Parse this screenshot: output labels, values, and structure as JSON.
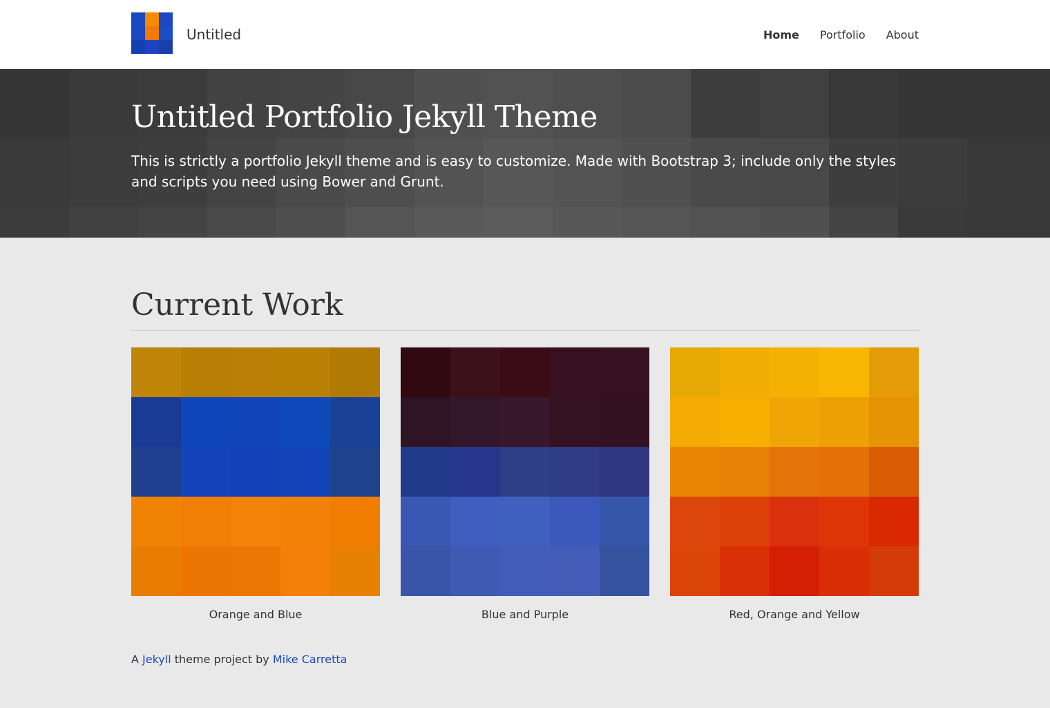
{
  "navbar": {
    "brand": "Untitled",
    "logo_colors": [
      "#1c47c0",
      "#f48a00",
      "#1c47c0",
      "#1c47c0",
      "#f07a08",
      "#1a4ec8",
      "#1240b0",
      "#1e44c2",
      "#1c3ea8"
    ],
    "items": [
      {
        "label": "Home",
        "active": true
      },
      {
        "label": "Portfolio",
        "active": false
      },
      {
        "label": "About",
        "active": false
      }
    ]
  },
  "hero": {
    "title": "Untitled Portfolio Jekyll Theme",
    "subtitle": "This is strictly a portfolio Jekyll theme and is easy to customize. Made with Bootstrap 3; include only the styles and scripts you need using Bower and Grunt.",
    "colors": [
      "#363636",
      "#3a3a3a",
      "#3c3c3c",
      "#424242",
      "#444444",
      "#484848",
      "#505050",
      "#525252",
      "#4f4f4f",
      "#4c4c4c",
      "#3e3e3e",
      "#404040",
      "#383838",
      "#363636",
      "#363636",
      "#363636",
      "#3a3a3a",
      "#3c3c3c",
      "#3e3e3e",
      "#444444",
      "#4a4a4a",
      "#4e4e4e",
      "#535353",
      "#575757",
      "#545454",
      "#505050",
      "#4a4a4a",
      "#484848",
      "#3e3e3e",
      "#3c3c3c",
      "#383838",
      "#383838",
      "#3c3c3c",
      "#404040",
      "#444444",
      "#4a4a4a",
      "#4e4e4e",
      "#555555",
      "#595959",
      "#5c5c5c",
      "#585858",
      "#555555",
      "#525252",
      "#505050",
      "#444444",
      "#3a3a3a",
      "#383838",
      "#383838"
    ]
  },
  "main": {
    "section_title": "Current Work",
    "cards": [
      {
        "caption": "Orange and Blue",
        "colors": [
          "#bf8408",
          "#b97e06",
          "#bb7f07",
          "#bb8006",
          "#b17a05",
          "#1a3b95",
          "#1145bc",
          "#1145b9",
          "#0d49b9",
          "#194195",
          "#213f8f",
          "#1344bb",
          "#1041b8",
          "#1344b9",
          "#1d438c",
          "#f18304",
          "#f17f06",
          "#f38309",
          "#f28107",
          "#f27d00",
          "#e87d02",
          "#ed7504",
          "#ee7605",
          "#f57f08",
          "#e88003"
        ]
      },
      {
        "caption": "Blue and Purple",
        "colors": [
          "#310911",
          "#3c111a",
          "#3b0c16",
          "#371021",
          "#371221",
          "#2e1424",
          "#32172d",
          "#37182c",
          "#331221",
          "#321120",
          "#213b8a",
          "#27368a",
          "#2e3f88",
          "#313c86",
          "#2f3780",
          "#3a57b4",
          "#3f5ec0",
          "#4060c0",
          "#3d58bd",
          "#3656ab",
          "#3855a9",
          "#3e5ab2",
          "#425cb9",
          "#435db6",
          "#34529e"
        ]
      },
      {
        "caption": "Red, Orange and Yellow",
        "colors": [
          "#e6a804",
          "#f2ad04",
          "#f4b103",
          "#f8b602",
          "#e59b07",
          "#f3aa02",
          "#f6ae00",
          "#f0a506",
          "#eda003",
          "#e69304",
          "#e98502",
          "#ea8107",
          "#e47309",
          "#e4700a",
          "#da5c05",
          "#dc480c",
          "#de4107",
          "#d8310b",
          "#de3507",
          "#d82902",
          "#d94607",
          "#d83007",
          "#d41f05",
          "#d92e06",
          "#d33b0a"
        ]
      }
    ]
  },
  "footer": {
    "prefix": "A ",
    "link1": "Jekyll",
    "middle": " theme project by ",
    "link2": "Mike Carretta"
  }
}
